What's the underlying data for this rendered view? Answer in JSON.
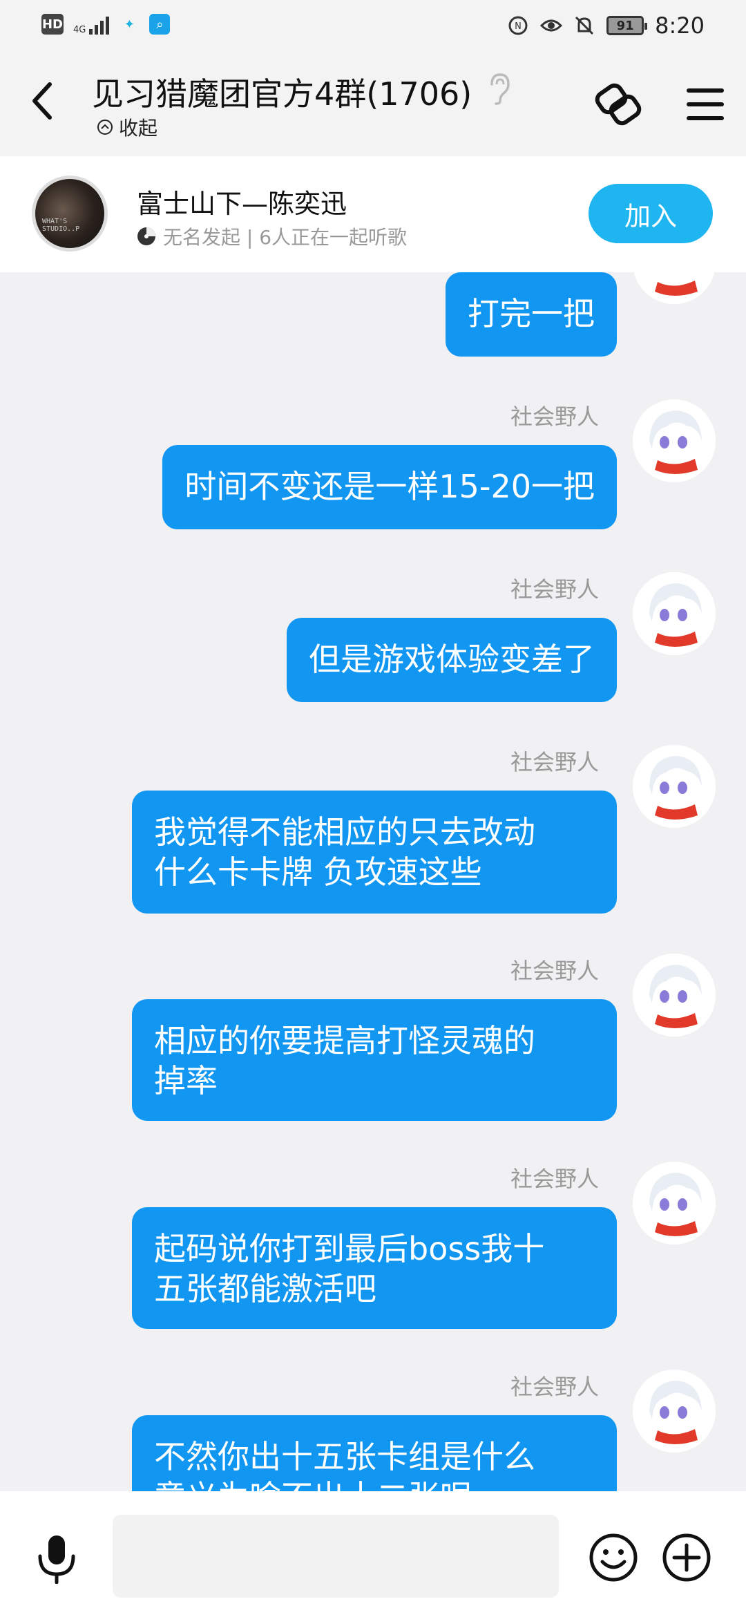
{
  "status_bar": {
    "hd": "HD",
    "network": "4G",
    "time": "8:20",
    "battery": "91"
  },
  "header": {
    "title": "见习猎魔团官方4群(1706)",
    "collapse_label": "收起"
  },
  "listen_together": {
    "song": "富士山下—陈奕迅",
    "subtitle": "无名发起 | 6人正在一起听歌",
    "join_label": "加入",
    "cover_text": "WHAT'S\nSTUDIO..P"
  },
  "messages": [
    {
      "sender": "",
      "text": "打完一把"
    },
    {
      "sender": "社会野人",
      "text": "时间不变还是一样15-20一把"
    },
    {
      "sender": "社会野人",
      "text": "但是游戏体验变差了"
    },
    {
      "sender": "社会野人",
      "text": "我觉得不能相应的只去改动\n什么卡卡牌 负攻速这些"
    },
    {
      "sender": "社会野人",
      "text": "相应的你要提高打怪灵魂的\n掉率"
    },
    {
      "sender": "社会野人",
      "text": "起码说你打到最后boss我十\n五张都能激活吧"
    },
    {
      "sender": "社会野人",
      "text": "不然你出十五张卡组是什么\n意义为啥不出十二张呢"
    }
  ],
  "colors": {
    "bubble": "#1196f2",
    "join_button": "#1fb5f0",
    "background": "#f1f1f3"
  },
  "icons": [
    "back-arrow-icon",
    "ear-icon",
    "collapse-icon",
    "link-icon",
    "menu-icon",
    "mic-icon",
    "emoji-icon",
    "plus-icon",
    "music-disc-icon"
  ]
}
